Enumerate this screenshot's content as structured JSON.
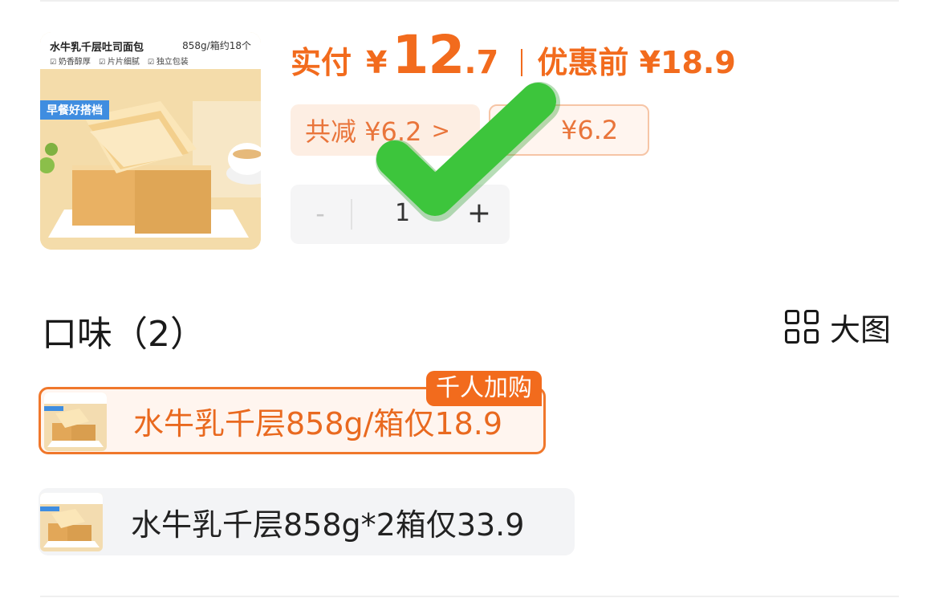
{
  "product": {
    "image_title": "水牛乳千层吐司面包",
    "image_spec": "858g/箱约18个",
    "image_features": [
      "奶香醇厚",
      "片片细腻",
      "独立包装"
    ],
    "image_badge": "早餐好搭档"
  },
  "price": {
    "label": "实付",
    "currency": "¥",
    "integer": "12",
    "decimal": ".7",
    "before_label": "优惠前 ¥18.9"
  },
  "discounts": {
    "total": "共减 ¥6.2",
    "total_chevron": ">",
    "coupon": "¥6.2"
  },
  "quantity": {
    "minus": "-",
    "value": "1",
    "plus": "+"
  },
  "flavor": {
    "title": "口味（2）",
    "view_toggle": "大图",
    "options": [
      {
        "label": "水牛乳千层858g/箱仅18.9",
        "tag": "千人加购",
        "selected": true
      },
      {
        "label": "水牛乳千层858g*2箱仅33.9",
        "selected": false
      }
    ]
  },
  "colors": {
    "accent": "#f26b1d",
    "check": "#3dc53c",
    "badge_blue": "#3f8de0"
  }
}
